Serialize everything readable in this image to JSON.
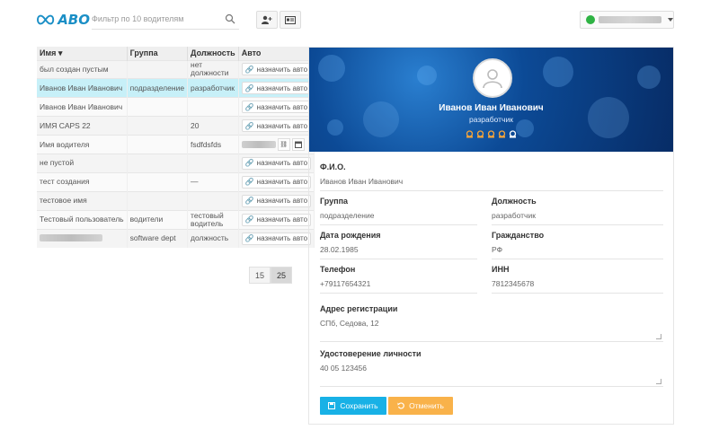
{
  "header": {
    "logo_text": "АВО",
    "filter_placeholder": "Фильтр по 10 водителям"
  },
  "table": {
    "columns": [
      "Имя ▾",
      "Группа",
      "Должность",
      "Авто"
    ],
    "assign_label": "назначить авто",
    "rows": [
      {
        "name": "был создан пустым",
        "group": "",
        "position": "нет должности"
      },
      {
        "name": "Иванов Иван Иванович",
        "group": "подразделение",
        "position": "разработчик"
      },
      {
        "name": "Иванов Иван Иванович",
        "group": "",
        "position": ""
      },
      {
        "name": "ИМЯ CAPS 22",
        "group": "",
        "position": "20"
      },
      {
        "name": "Имя водителя",
        "group": "",
        "position": "fsdfdsfds"
      },
      {
        "name": "не пустой",
        "group": "",
        "position": ""
      },
      {
        "name": "тест создания",
        "group": "",
        "position": "—"
      },
      {
        "name": "тестовое имя",
        "group": "",
        "position": ""
      },
      {
        "name": "Тестовый пользователь",
        "group": "водители",
        "position": "тестовый водитель"
      },
      {
        "name": "",
        "group": "software dept",
        "position": "должность"
      }
    ]
  },
  "pager": {
    "options": [
      "15",
      "25"
    ],
    "selected": "25"
  },
  "profile": {
    "name": "Иванов Иван Иванович",
    "role": "разработчик"
  },
  "form": {
    "fio_label": "Ф.И.О.",
    "fio_value": "Иванов Иван Иванович",
    "group_label": "Группа",
    "group_value": "подразделение",
    "position_label": "Должность",
    "position_value": "разработчик",
    "birth_label": "Дата рождения",
    "birth_value": "28.02.1985",
    "citizenship_label": "Гражданство",
    "citizenship_value": "РФ",
    "phone_label": "Телефон",
    "phone_value": "+79117654321",
    "inn_label": "ИНН",
    "inn_value": "7812345678",
    "address_label": "Адрес регистрации",
    "address_value": "СПб, Седова, 12",
    "id_label": "Удостоверение личности",
    "id_value": "40 05 123456",
    "save_label": "Сохранить",
    "cancel_label": "Отменить"
  },
  "colors": {
    "accent": "#18b1e6",
    "cancel": "#f9b24a",
    "selected_row": "#c7f0f8",
    "online": "#2fb344"
  }
}
